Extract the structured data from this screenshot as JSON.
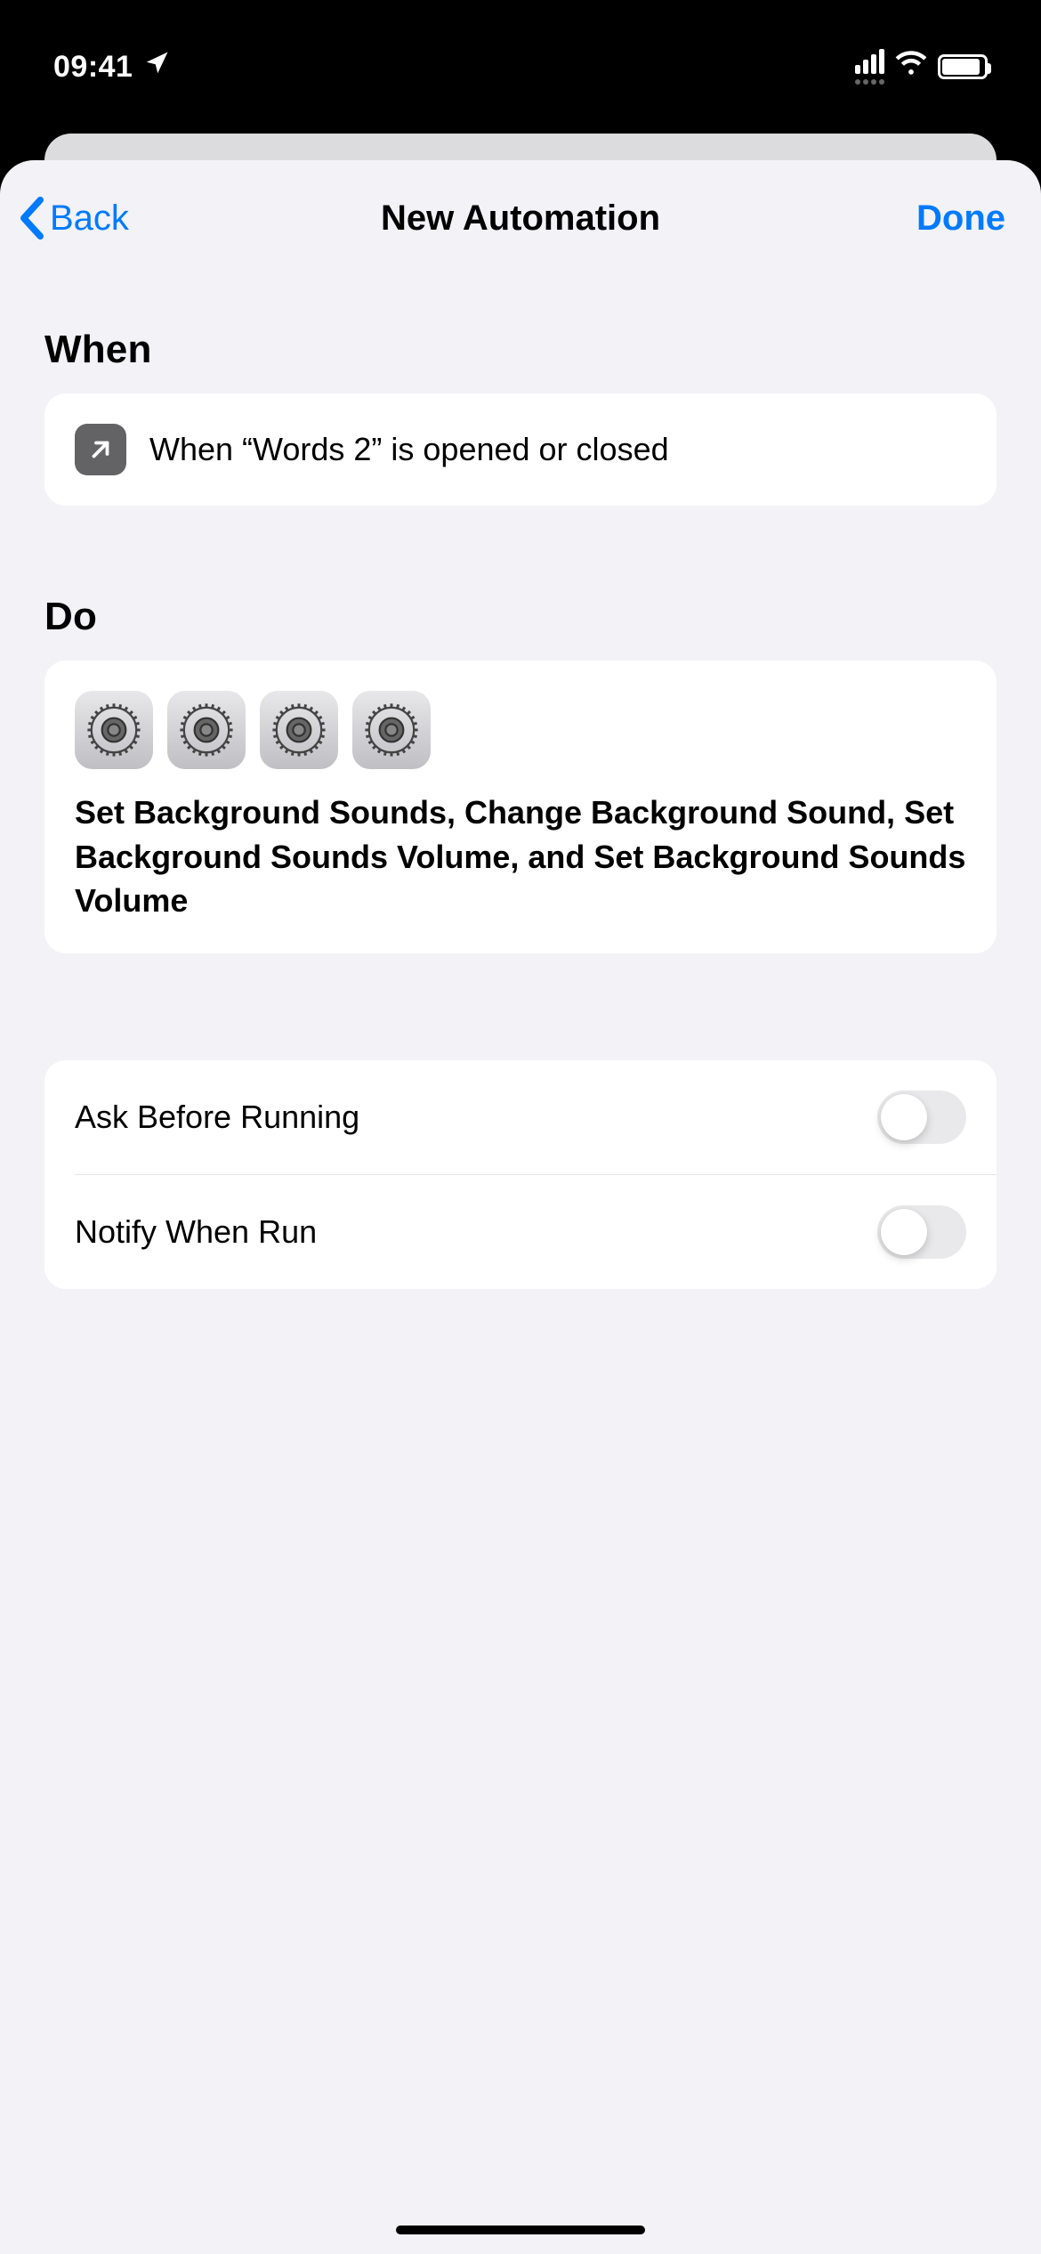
{
  "status": {
    "time": "09:41"
  },
  "nav": {
    "back_label": "Back",
    "title": "New Automation",
    "done_label": "Done"
  },
  "sections": {
    "when_header": "When",
    "do_header": "Do"
  },
  "when": {
    "text": "When “Words 2” is opened or closed"
  },
  "do": {
    "icon_count": 4,
    "text": "Set Background Sounds, Change Background Sound, Set Background Sounds Volume, and Set Background Sounds Volume"
  },
  "options": {
    "ask_before": {
      "label": "Ask Before Running",
      "on": false
    },
    "notify": {
      "label": "Notify When Run",
      "on": false
    }
  }
}
